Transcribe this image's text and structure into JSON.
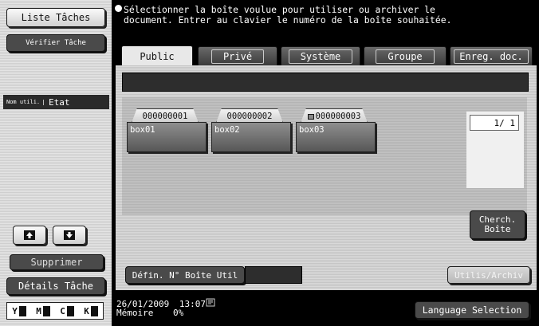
{
  "left": {
    "liste_taches": "Liste Tâches",
    "verifier_tache": "Vérifier Tâche",
    "header_col1": "Nom utili.",
    "header_col2": "Etat",
    "supprimer": "Supprimer",
    "details_tache": "Détails Tâche",
    "toner": [
      "Y",
      "M",
      "C",
      "K"
    ]
  },
  "message": {
    "line1": "Sélectionner la boîte voulue pour utiliser ou archiver le",
    "line2": "document. Entrer au clavier le numéro de la boîte souhaitée."
  },
  "tabs": [
    {
      "label": "Public",
      "active": true
    },
    {
      "label": "Privé",
      "active": false
    },
    {
      "label": "Système",
      "active": false
    },
    {
      "label": "Groupe",
      "active": false
    },
    {
      "label": "Enreg. doc.",
      "active": false
    }
  ],
  "boxes": [
    {
      "number": "000000001",
      "name": "box01",
      "locked": false
    },
    {
      "number": "000000002",
      "name": "box02",
      "locked": false
    },
    {
      "number": "000000003",
      "name": "box03",
      "locked": true
    }
  ],
  "page_indicator": "1/  1",
  "cherch_boite": "Cherch. Boîte",
  "defin_boite": "Défin. N° Boîte Util",
  "utilis_archiv": "Utilis/Archiv",
  "status": {
    "date": "26/01/2009",
    "time": "13:07",
    "memoire_label": "Mémoire",
    "memoire_value": "0%"
  },
  "language_selection": "Language Selection"
}
